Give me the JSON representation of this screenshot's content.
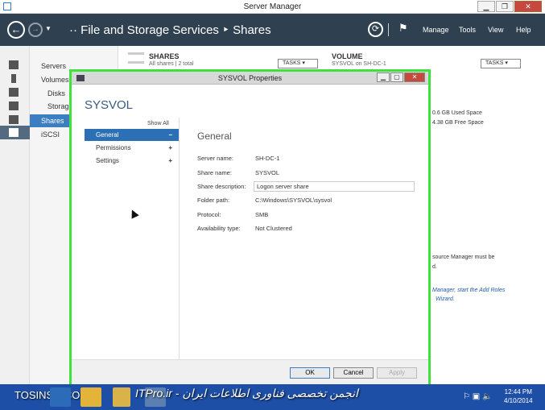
{
  "window": {
    "title": "Server Manager",
    "min": "▁",
    "max": "❐",
    "close": "✕"
  },
  "header": {
    "breadcrumb": "·· File and Storage Services ‣ Shares",
    "menu": [
      "Manage",
      "Tools",
      "View",
      "Help"
    ]
  },
  "nav": {
    "items": [
      "Servers",
      "Volumes",
      "Disks",
      "Storag",
      "Shares",
      "iSCSI"
    ],
    "selected": "Shares"
  },
  "background": {
    "shares_title": "SHARES",
    "shares_sub": "All shares | 2 total",
    "tasks_label": "TASKS",
    "volume_title": "VOLUME",
    "volume_sub": "SYSVOL on SH-DC-1",
    "used_space": "0.6 GB Used Space",
    "free_space": "4.38 GB Free Space",
    "fsrm_line": "source Manager must be",
    "fsrm_d": "d.",
    "link1": "Manager, start the Add Roles",
    "link2": "Wizard."
  },
  "dialog": {
    "title": "SYSVOL Properties",
    "heading": "SYSVOL",
    "show_all": "Show All",
    "side_items": [
      {
        "label": "General",
        "sym": "−"
      },
      {
        "label": "Permissions",
        "sym": "+"
      },
      {
        "label": "Settings",
        "sym": "+"
      }
    ],
    "section": "General",
    "props": {
      "server_name_label": "Server name:",
      "server_name": "SH-DC-1",
      "share_name_label": "Share name:",
      "share_name": "SYSVOL",
      "share_desc_label": "Share description:",
      "share_desc": "Logon server share",
      "folder_path_label": "Folder path:",
      "folder_path": "C:\\Windows\\SYSVOL\\sysvol",
      "protocol_label": "Protocol:",
      "protocol": "SMB",
      "availability_label": "Availability type:",
      "availability": "Not Clustered"
    },
    "buttons": {
      "ok": "OK",
      "cancel": "Cancel",
      "apply": "Apply"
    }
  },
  "taskbar": {
    "watermark_left": "TOSINSO.COM",
    "watermark_right": "ITPro.ir - انجمن تخصصی فناوری اطلاعات ایران",
    "time": "12:44 PM",
    "date": "4/10/2014"
  }
}
